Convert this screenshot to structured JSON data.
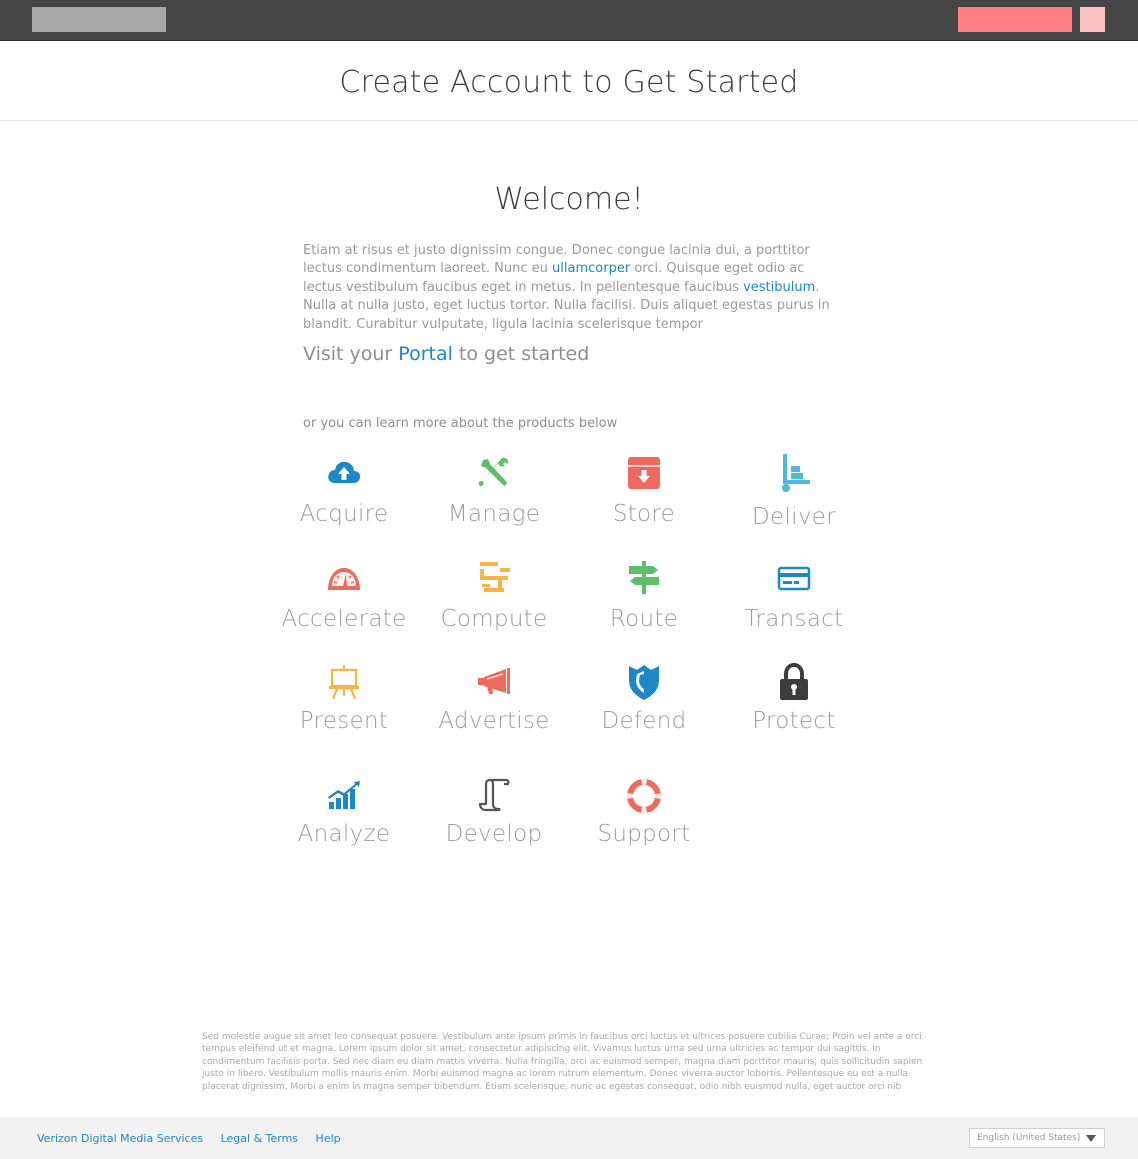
{
  "header": {
    "title": "Create Account to Get Started"
  },
  "main": {
    "welcome": "Welcome!",
    "intro": {
      "part1": "Etiam at risus et justo dignissim congue. Donec congue lacinia dui, a porttitor lectus condimentum laoreet. Nunc eu ",
      "link1": "ullamcorper",
      "part2": " orci. Quisque eget odio ac lectus vestibulum faucibus eget in metus. In pellentesque faucibus ",
      "link2": "vestibulum",
      "part3": ". Nulla at nulla justo, eget luctus tortor. Nulla facilisi. Duis aliquet egestas purus in blandit. Curabitur vulputate, ligula lacinia scelerisque tempor"
    },
    "portal": {
      "prefix": "Visit your ",
      "link": "Portal",
      "suffix": " to get started"
    },
    "learn_more": "or you can learn more about the products below"
  },
  "products": [
    {
      "label": "Acquire",
      "icon": "cloud-upload-icon",
      "color": "#1e87c6"
    },
    {
      "label": "Manage",
      "icon": "tools-icon",
      "color": "#5cc06a"
    },
    {
      "label": "Store",
      "icon": "storage-box-icon",
      "color": "#ef6a5e"
    },
    {
      "label": "Deliver",
      "icon": "hand-truck-icon",
      "color": "#4fb8de"
    },
    {
      "label": "Accelerate",
      "icon": "speedometer-icon",
      "color": "#ef6a5e"
    },
    {
      "label": "Compute",
      "icon": "flowchart-icon",
      "color": "#f8b545"
    },
    {
      "label": "Route",
      "icon": "signpost-icon",
      "color": "#5cc06a"
    },
    {
      "label": "Transact",
      "icon": "credit-card-icon",
      "color": "#1e87c6"
    },
    {
      "label": "Present",
      "icon": "easel-icon",
      "color": "#f8b545"
    },
    {
      "label": "Advertise",
      "icon": "megaphone-icon",
      "color": "#ef6a5e"
    },
    {
      "label": "Defend",
      "icon": "shield-icon",
      "color": "#1e87c6"
    },
    {
      "label": "Protect",
      "icon": "padlock-icon",
      "color": "#3d3d3d"
    },
    {
      "label": "Analyze",
      "icon": "bar-chart-icon",
      "color": "#1e87c6"
    },
    {
      "label": "Develop",
      "icon": "scroll-icon",
      "color": "#555555"
    },
    {
      "label": "Support",
      "icon": "lifebuoy-icon",
      "color": "#ef6a5e"
    }
  ],
  "legal": "Sed molestie augue sit amet leo consequat posuere. Vestibulum ante ipsum primis in faucibus orci luctus et ultrices posuere cubilia Curae; Proin vel ante a orci tempus eleifend ut et magna. Lorem ipsum dolor sit amet, consectetur adipiscing elit. Vivamus luctus urna sed urna ultricies ac tempor dui sagittis. In condimentum facilisis porta. Sed nec diam eu diam mattis viverra. Nulla fringilla, orci ac euismod semper, magna diam porttitor mauris, quis sollicitudin sapien justo in libero. Vestibulum mollis mauris enim. Morbi euismod magna ac lorem rutrum elementum. Donec viverra auctor lobortis. Pellentesque eu est a nulla placerat dignissim. Morbi a enim in magna semper bibendum. Etiam scelerisque, nunc ac egestas consequat, odio nibh euismod nulla, eget auctor orci nib",
  "footer": {
    "links": [
      "Verizon Digital Media Services",
      "Legal & Terms",
      "Help"
    ],
    "language": "English (United States)"
  },
  "colors": {
    "topbar": "#454545",
    "accent_link": "#1e87c6",
    "cta_primary": "#ff8082",
    "cta_secondary": "#fbc2c3"
  }
}
